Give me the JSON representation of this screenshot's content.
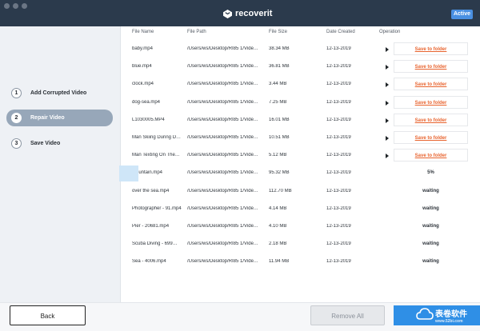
{
  "app": {
    "logo_text": "recoverit",
    "badge": "Active",
    "colors": {
      "titlebar": "#2b3a4c",
      "accent": "#4a90e2",
      "save": "#e8632e",
      "active_step": "#97a7b9"
    }
  },
  "steps": [
    {
      "num": "1",
      "label": "Add Corrupted Video",
      "active": false
    },
    {
      "num": "2",
      "label": "Repair Video",
      "active": true
    },
    {
      "num": "3",
      "label": "Save Video",
      "active": false
    }
  ],
  "table": {
    "headers": [
      "File Name",
      "File Path",
      "File Size",
      "Date Created",
      "Operation"
    ],
    "rows": [
      {
        "name": "baby.mp4",
        "path": "/Users/ws/Desktop/RI85 1/Vide…",
        "size": "38.34 MB",
        "date": "12-13-2019",
        "op": "save",
        "op_label": "Save to folder"
      },
      {
        "name": "blue.mp4",
        "path": "/Users/ws/Desktop/RI85 1/Vide…",
        "size": "36.81 MB",
        "date": "12-13-2019",
        "op": "save",
        "op_label": "Save to folder"
      },
      {
        "name": "clock.mp4",
        "path": "/Users/ws/Desktop/RI85 1/Vide…",
        "size": "3.44 MB",
        "date": "12-13-2019",
        "op": "save",
        "op_label": "Save to folder"
      },
      {
        "name": "dog-sea.mp4",
        "path": "/Users/ws/Desktop/RI85 1/Vide…",
        "size": "7.25 MB",
        "date": "12-13-2019",
        "op": "save",
        "op_label": "Save to folder"
      },
      {
        "name": "L1030005.MP4",
        "path": "/Users/ws/Desktop/RI85 1/Vide…",
        "size": "16.01 MB",
        "date": "12-13-2019",
        "op": "save",
        "op_label": "Save to folder"
      },
      {
        "name": "Man Skiing During D…",
        "path": "/Users/ws/Desktop/RI85 1/Vide…",
        "size": "10.51 MB",
        "date": "12-13-2019",
        "op": "save",
        "op_label": "Save to folder"
      },
      {
        "name": "Man Texting On The…",
        "path": "/Users/ws/Desktop/RI85 1/Vide…",
        "size": "5.12 MB",
        "date": "12-13-2019",
        "op": "save",
        "op_label": "Save to folder"
      },
      {
        "name": "mountain.mp4",
        "path": "/Users/ws/Desktop/RI85 1/Vide…",
        "size": "95.32 MB",
        "date": "12-13-2019",
        "op": "status",
        "op_label": "5%"
      },
      {
        "name": "over the sea.mp4",
        "path": "/Users/ws/Desktop/RI85 1/Vide…",
        "size": "112.70 MB",
        "date": "12-13-2019",
        "op": "status",
        "op_label": "waiting"
      },
      {
        "name": "Photographer - 91.mp4",
        "path": "/Users/ws/Desktop/RI85 1/Vide…",
        "size": "4.14 MB",
        "date": "12-13-2019",
        "op": "status",
        "op_label": "waiting"
      },
      {
        "name": "Pier - 20681.mp4",
        "path": "/Users/ws/Desktop/RI85 1/Vide…",
        "size": "4.10 MB",
        "date": "12-13-2019",
        "op": "status",
        "op_label": "waiting"
      },
      {
        "name": "Scuba Diving - 699…",
        "path": "/Users/ws/Desktop/RI85 1/Vide…",
        "size": "2.18 MB",
        "date": "12-13-2019",
        "op": "status",
        "op_label": "waiting"
      },
      {
        "name": "Sea - 4006.mp4",
        "path": "/Users/ws/Desktop/RI85 1/Vide…",
        "size": "11.94 MB",
        "date": "12-13-2019",
        "op": "status",
        "op_label": "waiting"
      }
    ]
  },
  "footer": {
    "back_label": "Back",
    "remove_label": "Remove All"
  },
  "watermark": {
    "text": "表卷软件",
    "url": "www.52bi.com"
  }
}
